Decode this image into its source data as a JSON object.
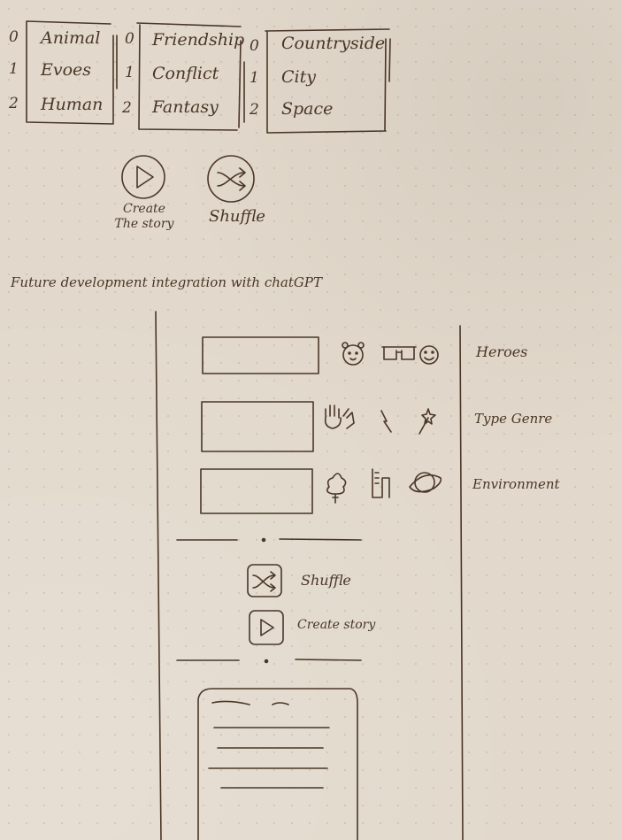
{
  "lists": [
    {
      "numbers": [
        "0",
        "1",
        "2"
      ],
      "items": [
        "Animal",
        "Evoes",
        "Human"
      ]
    },
    {
      "numbers": [
        "0",
        "1",
        "2"
      ],
      "items": [
        "Friendship",
        "Conflict",
        "Fantasy"
      ]
    },
    {
      "numbers": [
        "0",
        "1",
        "2"
      ],
      "items": [
        "Countryside",
        "City",
        "Space"
      ]
    }
  ],
  "top_buttons": {
    "create_label": "Create\nThe story",
    "shuffle_label": "Shuffle"
  },
  "future_note": "Future development integration with chatGPT",
  "wireframe": {
    "rows": [
      {
        "label": "Heroes",
        "icons": [
          "bear-icon",
          "glasses-icon",
          "smiley-icon"
        ]
      },
      {
        "label": "Type Genre",
        "icons": [
          "hand-icon",
          "lightning-icon",
          "magic-wand-icon"
        ]
      },
      {
        "label": "Environment",
        "icons": [
          "tree-icon",
          "building-icon",
          "planet-icon"
        ]
      }
    ],
    "shuffle_label": "Shuffle",
    "create_story_label": "Create story"
  },
  "colors": {
    "ink": "#4a3626",
    "paper": "#e2d9cc"
  }
}
